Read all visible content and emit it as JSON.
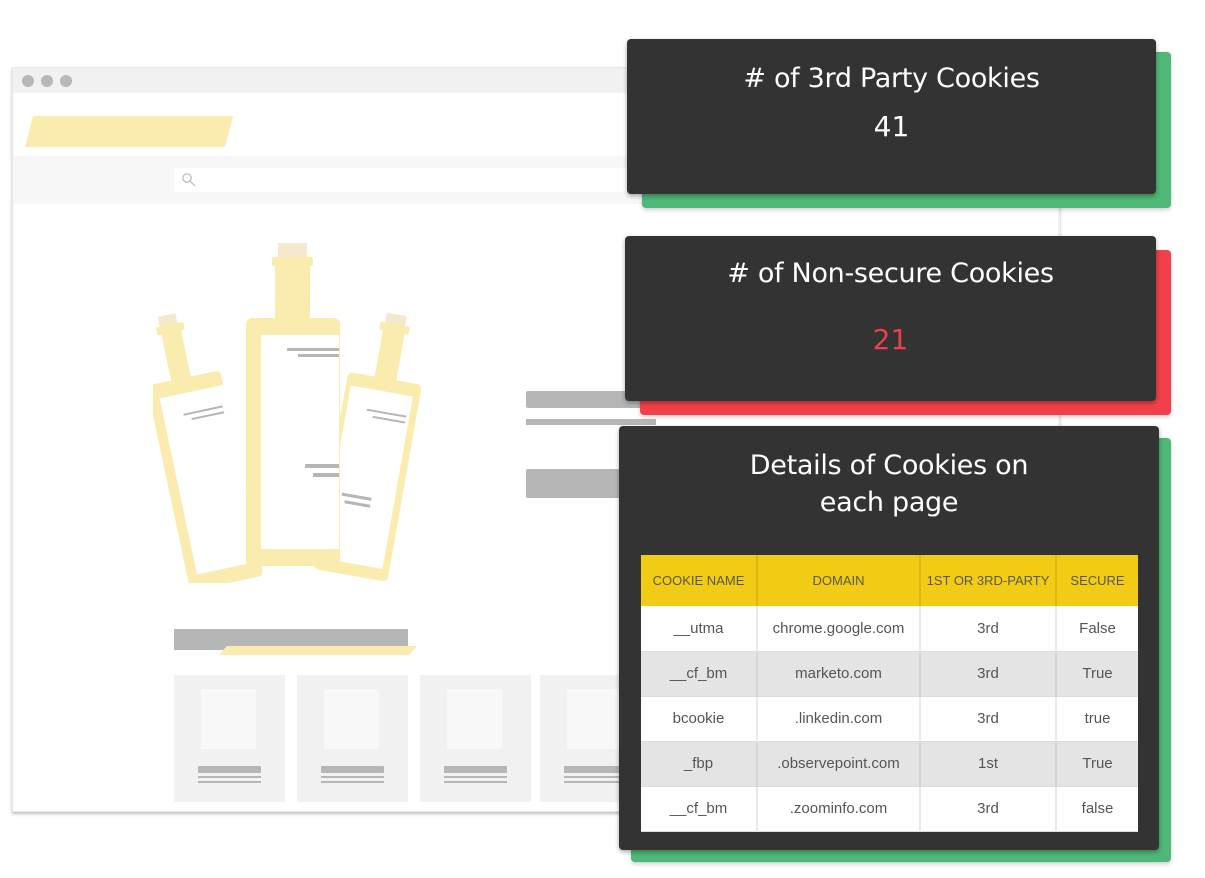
{
  "browser": {
    "window_dots": [
      "close",
      "minimize",
      "maximize"
    ],
    "search_icon": "search-icon"
  },
  "cards": {
    "third_party": {
      "title": "# of 3rd Party Cookies",
      "value": "41",
      "accent_color": "#4fb777",
      "value_color": "#ffffff"
    },
    "non_secure": {
      "title": "# of Non-secure Cookies",
      "value": "21",
      "accent_color": "#f1404a",
      "value_color": "#ee3e48"
    },
    "details": {
      "title_line1": "Details of Cookies on",
      "title_line2": "each page",
      "accent_color": "#4fb777",
      "table": {
        "headers": [
          "Cookie Name",
          "Domain",
          "1st or 3rd-Party",
          "Secure"
        ],
        "rows": [
          [
            "__utma",
            "chrome.google.com",
            "3rd",
            "False"
          ],
          [
            "__cf_bm",
            "marketo.com",
            "3rd",
            "True"
          ],
          [
            "bcookie",
            ".linkedin.com",
            "3rd",
            "true"
          ],
          [
            "_fbp",
            ".observepoint.com",
            "1st",
            "True"
          ],
          [
            "__cf_bm",
            ".zoominfo.com",
            "3rd",
            "false"
          ]
        ]
      }
    }
  },
  "colors": {
    "card_bg": "#333333",
    "header_yellow": "#f2cb14",
    "placeholder_yellow": "#faecae",
    "placeholder_gray": "#b6b6b6"
  }
}
